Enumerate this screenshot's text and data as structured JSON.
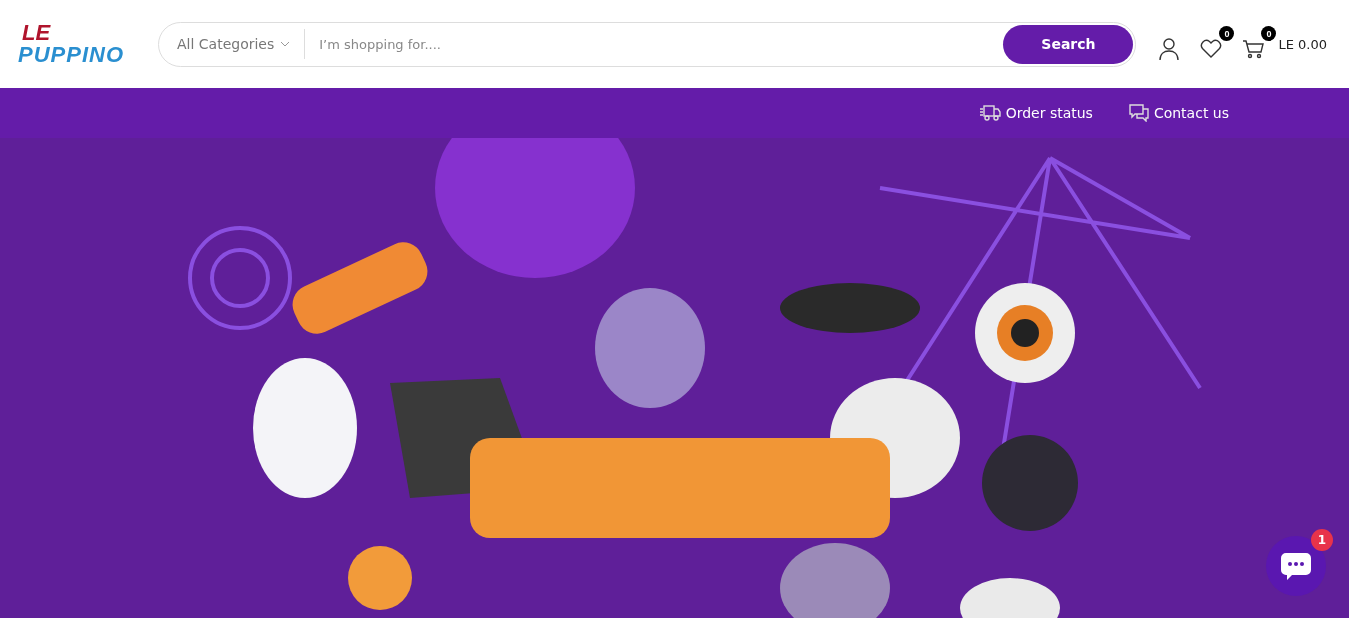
{
  "logo": {
    "line_1": "LE",
    "line_2": "PUPPINO"
  },
  "search": {
    "category": "All Categories",
    "placeholder": "I’m shopping for....",
    "button": "Search"
  },
  "header_icons": {
    "wishlist_count": "0",
    "cart_count": "0",
    "cart_total": "LE 0.00"
  },
  "nav_links": [
    {
      "kind": "truck",
      "label": "Order status"
    },
    {
      "kind": "chat",
      "label": "Contact us"
    }
  ],
  "chat_widget": {
    "badge": "1"
  }
}
